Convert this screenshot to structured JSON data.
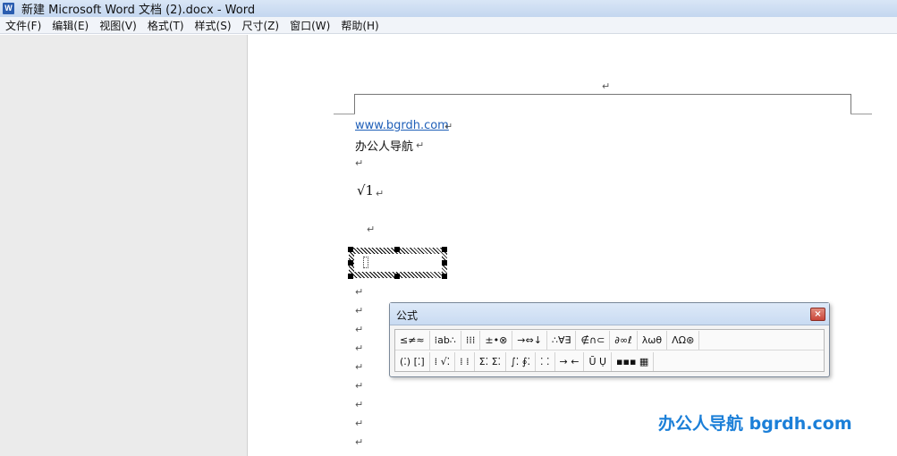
{
  "window": {
    "title": "新建 Microsoft Word 文档 (2).docx - Word",
    "app_icon": "W"
  },
  "menubar": {
    "items": [
      "文件(F)",
      "编辑(E)",
      "视图(V)",
      "格式(T)",
      "样式(S)",
      "尺寸(Z)",
      "窗口(W)",
      "帮助(H)"
    ]
  },
  "document": {
    "paragraph_mark": "↵",
    "link_text": "www.bgrdh.com",
    "line2_text": "办公人导航",
    "sqrt_equation": "√1",
    "eq_object_content": "⁚"
  },
  "formula_toolbar": {
    "title": "公式",
    "close_label": "×",
    "row1": [
      "≤≠≈",
      "⁞ab∴",
      "⁞⁞⁞",
      "±•⊗",
      "→⇔↓",
      "∴∀∃",
      "∉∩⊂",
      "∂∞ℓ",
      "λωθ",
      "ΛΩ⊛"
    ],
    "row2": [
      "(⁚) [⁚]",
      "⁞ √⁚",
      "⁞ ⁞",
      "Σ⁚ Σ⁚",
      "∫⁚ ∮⁚",
      "⁚ ⁚",
      "→ ←",
      "Ū Ụ",
      "▪▪▪ ▦"
    ]
  },
  "watermark": {
    "text": "办公人导航  bgrdh.com"
  },
  "colors": {
    "link": "#1f5fb8",
    "watermark": "#1b7fd8",
    "title_bar": "#c3d6ef"
  }
}
